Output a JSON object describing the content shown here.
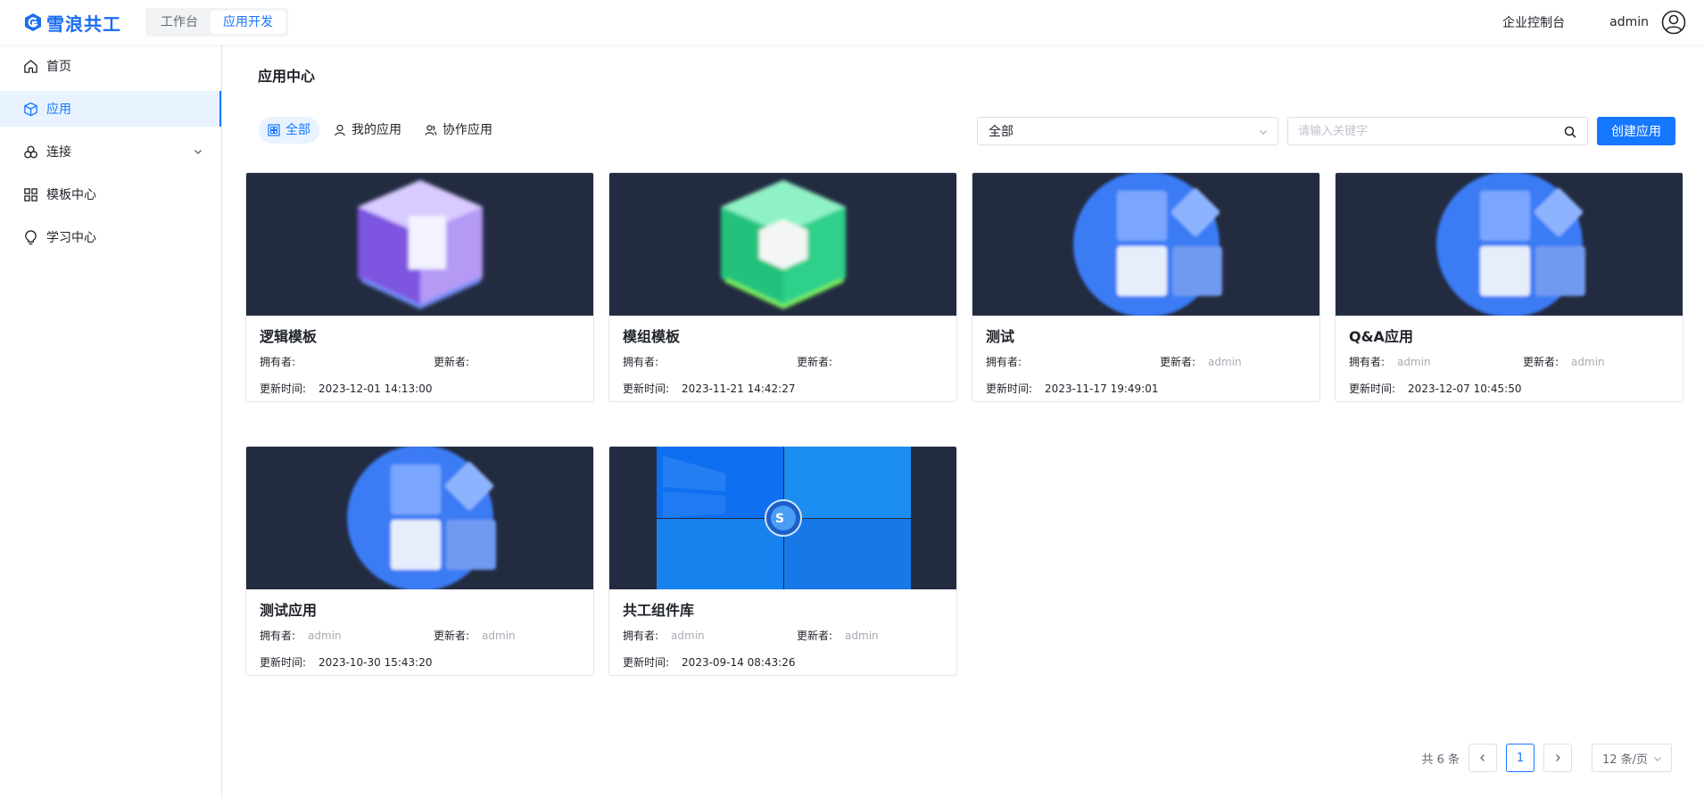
{
  "header": {
    "logo_text": "雪浪共工",
    "tabs": [
      {
        "label": "工作台"
      },
      {
        "label": "应用开发"
      }
    ],
    "console_link": "企业控制台",
    "user_name": "admin"
  },
  "sidebar": {
    "items": [
      {
        "label": "首页",
        "icon": "home-icon"
      },
      {
        "label": "应用",
        "icon": "cube-icon"
      },
      {
        "label": "连接",
        "icon": "connection-icon"
      },
      {
        "label": "模板中心",
        "icon": "grid-icon"
      },
      {
        "label": "学习中心",
        "icon": "bulb-icon"
      }
    ]
  },
  "main": {
    "title": "应用中心",
    "filter_tabs": [
      {
        "label": "全部",
        "icon": "all-icon"
      },
      {
        "label": "我的应用",
        "icon": "user-icon"
      },
      {
        "label": "协作应用",
        "icon": "team-icon"
      }
    ],
    "select_value": "全部",
    "search_placeholder": "请输入关键字",
    "create_button": "创建应用",
    "owner_label": "拥有者:",
    "updater_label": "更新者:",
    "time_label": "更新时间:",
    "cards": [
      {
        "title": "逻辑模板",
        "owner": "",
        "updater": "",
        "updated": "2023-12-01 14:13:00",
        "thumb": "purple-cube"
      },
      {
        "title": "模组模板",
        "owner": "",
        "updater": "",
        "updated": "2023-11-21 14:42:27",
        "thumb": "green-cube"
      },
      {
        "title": "测试",
        "owner": "",
        "updater": "admin",
        "updated": "2023-11-17 19:49:01",
        "thumb": "app-icon"
      },
      {
        "title": "Q&A应用",
        "owner": "admin",
        "updater": "admin",
        "updated": "2023-12-07 10:45:50",
        "thumb": "app-icon"
      },
      {
        "title": "测试应用",
        "owner": "admin",
        "updater": "admin",
        "updated": "2023-10-30 15:43:20",
        "thumb": "app-icon"
      },
      {
        "title": "共工组件库",
        "owner": "admin",
        "updater": "admin",
        "updated": "2023-09-14 08:43:26",
        "thumb": "blue-windows"
      }
    ],
    "pagination": {
      "total": "共 6 条",
      "current_page": "1",
      "page_size": "12 条/页"
    }
  },
  "colors": {
    "accent": "#1677ff",
    "thumb_bg": "#222b40"
  }
}
